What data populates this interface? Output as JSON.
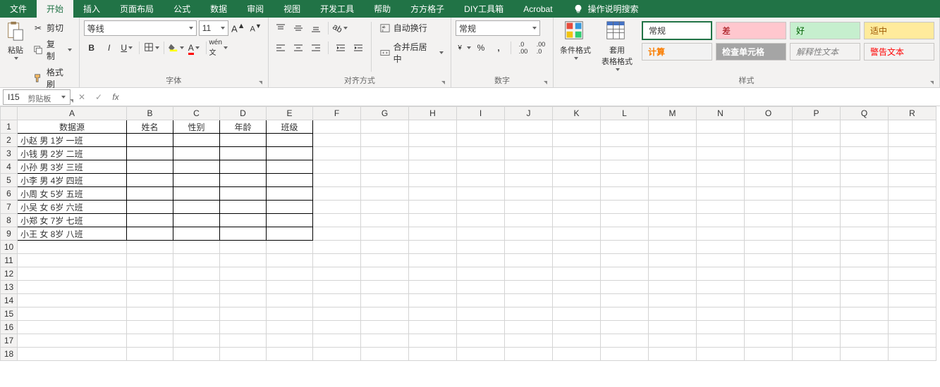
{
  "tabs": {
    "file": "文件",
    "home": "开始",
    "insert": "插入",
    "pagelayout": "页面布局",
    "formulas": "公式",
    "data": "数据",
    "review": "审阅",
    "view": "视图",
    "developer": "开发工具",
    "help": "帮助",
    "fangge": "方方格子",
    "diy": "DIY工具箱",
    "acrobat": "Acrobat",
    "tellme": "操作说明搜索"
  },
  "clipboard": {
    "paste": "粘贴",
    "cut": "剪切",
    "copy": "复制",
    "formatpainter": "格式刷",
    "group": "剪贴板"
  },
  "font": {
    "name": "等线",
    "size": "11",
    "group": "字体"
  },
  "align": {
    "wrap": "自动换行",
    "merge": "合并后居中",
    "group": "对齐方式"
  },
  "number": {
    "fmt": "常规",
    "group": "数字"
  },
  "styles": {
    "cond": "条件格式",
    "table": "套用\n表格格式",
    "normal": "常规",
    "bad": "差",
    "good": "好",
    "neutral": "适中",
    "calc": "计算",
    "check": "检查单元格",
    "explain": "解释性文本",
    "warn": "警告文本",
    "group": "样式"
  },
  "namebox": "I15",
  "sheet": {
    "cols": [
      "A",
      "B",
      "C",
      "D",
      "E",
      "F",
      "G",
      "H",
      "I",
      "J",
      "K",
      "L",
      "M",
      "N",
      "O",
      "P",
      "Q",
      "R"
    ],
    "headers": {
      "A": "数据源",
      "B": "姓名",
      "C": "性别",
      "D": "年龄",
      "E": "班级"
    },
    "rows": [
      {
        "r": 2,
        "A": "小赵 男 1岁 一班"
      },
      {
        "r": 3,
        "A": "小钱 男 2岁 二班"
      },
      {
        "r": 4,
        "A": "小孙 男 3岁 三班"
      },
      {
        "r": 5,
        "A": "小李 男 4岁 四班"
      },
      {
        "r": 6,
        "A": "小周 女 5岁 五班"
      },
      {
        "r": 7,
        "A": "小吴 女 6岁 六班"
      },
      {
        "r": 8,
        "A": "小郑 女 7岁 七班"
      },
      {
        "r": 9,
        "A": "小王 女 8岁 八班"
      }
    ],
    "maxrow": 18
  }
}
